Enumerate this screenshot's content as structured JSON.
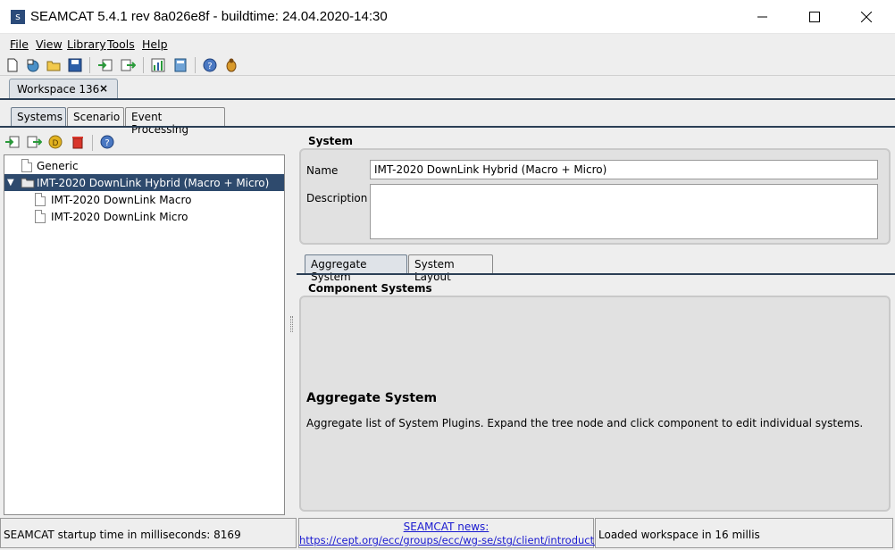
{
  "window": {
    "app_icon_letter": "s",
    "title": "SEAMCAT 5.4.1 rev 8a026e8f - buildtime: 24.04.2020-14:30"
  },
  "menu": {
    "items": [
      {
        "label": "File"
      },
      {
        "label": "View"
      },
      {
        "label": "Library"
      },
      {
        "label": "Tools"
      },
      {
        "label": "Help"
      }
    ]
  },
  "workspace_tab": {
    "label": "Workspace 136",
    "close": "×"
  },
  "tabs": [
    {
      "label": "Systems"
    },
    {
      "label": "Scenario"
    },
    {
      "label": "Event Processing"
    }
  ],
  "tree": {
    "items": [
      {
        "label": "Generic"
      },
      {
        "label": "IMT-2020 DownLink Hybrid (Macro + Micro)",
        "expander": "▼"
      },
      {
        "label": "IMT-2020 DownLink Macro"
      },
      {
        "label": "IMT-2020 DownLink Micro"
      }
    ]
  },
  "system": {
    "title": "System",
    "name_label": "Name",
    "name_value": "IMT-2020 DownLink Hybrid (Macro + Micro)",
    "description_label": "Description",
    "description_value": ""
  },
  "subtabs": [
    {
      "label": "Aggregate System"
    },
    {
      "label": "System Layout"
    }
  ],
  "component": {
    "title": "Component Systems",
    "heading": "Aggregate System",
    "text": "Aggregate list of System Plugins. Expand the tree node and click component to edit individual systems."
  },
  "status": {
    "startup": "SEAMCAT startup time in milliseconds: 8169",
    "news_label": "SEAMCAT news:",
    "news_link": "https://cept.org/ecc/groups/ecc/wg-se/stg/client/introduction/",
    "loaded": "Loaded workspace in 16 millis"
  },
  "colors": {
    "selection": "#2e4a6d",
    "link": "#1a1ad0",
    "accent_rule": "#2b3f55"
  }
}
